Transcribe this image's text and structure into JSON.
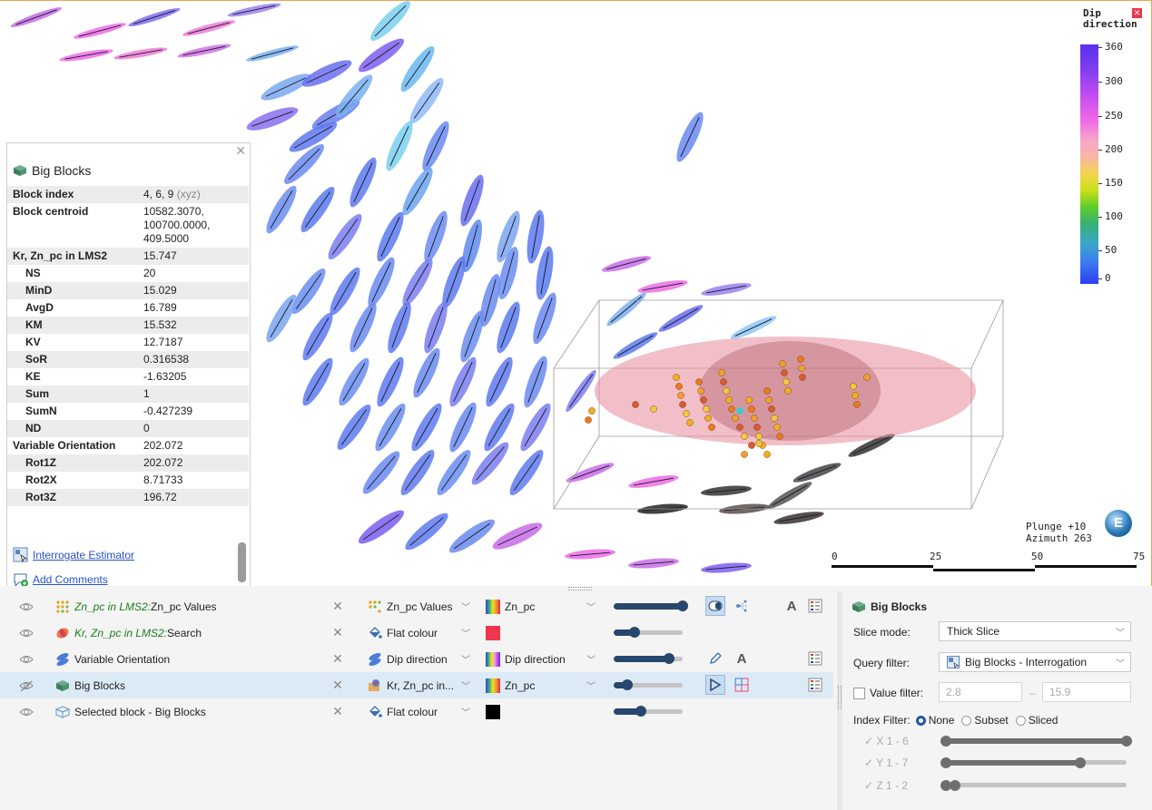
{
  "legend": {
    "title": "Dip direction",
    "ticks": [
      "360",
      "300",
      "250",
      "200",
      "150",
      "100",
      "50",
      "0"
    ]
  },
  "info_panel": {
    "title": "Big Blocks",
    "block_index_label": "Block index",
    "block_index_value": "4, 6, 9",
    "block_index_suffix": "(xyz)",
    "block_centroid_label": "Block centroid",
    "block_centroid_lines": [
      "10582.3070,",
      "100700.0000,",
      "409.5000"
    ],
    "rows": [
      {
        "k": "Kr, Zn_pc in LMS2",
        "v": "15.747",
        "indent": false
      },
      {
        "k": "NS",
        "v": "20",
        "indent": true
      },
      {
        "k": "MinD",
        "v": "15.029",
        "indent": true
      },
      {
        "k": "AvgD",
        "v": "16.789",
        "indent": true
      },
      {
        "k": "KM",
        "v": "15.532",
        "indent": true
      },
      {
        "k": "KV",
        "v": "12.7187",
        "indent": true
      },
      {
        "k": "SoR",
        "v": "0.316538",
        "indent": true
      },
      {
        "k": "KE",
        "v": "-1.63205",
        "indent": true
      },
      {
        "k": "Sum",
        "v": "1",
        "indent": true
      },
      {
        "k": "SumN",
        "v": "-0.427239",
        "indent": true
      },
      {
        "k": "ND",
        "v": "0",
        "indent": true
      },
      {
        "k": "Variable Orientation",
        "v": "202.072",
        "indent": false
      },
      {
        "k": "Rot1Z",
        "v": "202.072",
        "indent": true
      },
      {
        "k": "Rot2X",
        "v": "8.71733",
        "indent": true
      },
      {
        "k": "Rot3Z",
        "v": "196.72",
        "indent": true
      }
    ],
    "interrogate_link": "Interrogate Estimator",
    "comments_link": "Add Comments"
  },
  "view": {
    "plunge": "Plunge +10",
    "azimuth": "Azimuth 263",
    "compass_letter": "E",
    "scale_labels": [
      "0",
      "25",
      "50",
      "75"
    ]
  },
  "layers": [
    {
      "name_italic": "Zn_pc in LMS2:",
      "name": " Zn_pc Values",
      "colour_mode": "Zn_pc Values",
      "swatch_label": "Zn_pc",
      "icon": "points-icon",
      "opacity": 1.0,
      "selected": false,
      "hidden": false
    },
    {
      "name_italic": "Kr, Zn_pc in LMS2:",
      "name": " Search",
      "colour_mode": "Flat colour",
      "swatch_label": "",
      "icon": "search-ellipsoid-icon",
      "opacity": 0.3,
      "selected": false,
      "hidden": false
    },
    {
      "name_italic": "",
      "name": "Variable Orientation",
      "colour_mode": "Dip direction",
      "swatch_label": "Dip direction",
      "icon": "orientation-icon",
      "opacity": 0.8,
      "selected": false,
      "hidden": false
    },
    {
      "name_italic": "",
      "name": "Big Blocks",
      "colour_mode": "Kr, Zn_pc in...",
      "swatch_label": "Zn_pc",
      "icon": "block-model-icon",
      "opacity": 0.2,
      "selected": true,
      "hidden": true
    },
    {
      "name_italic": "",
      "name": "Selected block - Big Blocks",
      "colour_mode": "Flat colour",
      "swatch_label": "",
      "icon": "selected-block-icon",
      "opacity": 0.4,
      "selected": false,
      "hidden": false
    }
  ],
  "colors": {
    "flat_red": "#ef3550",
    "flat_black": "#000000",
    "accent": "#27476e",
    "viewport_border": "#f2a64a"
  },
  "properties": {
    "title": "Big Blocks",
    "slice_mode_label": "Slice mode:",
    "slice_mode_value": "Thick Slice",
    "query_filter_label": "Query filter:",
    "query_filter_value": "Big Blocks - Interrogation",
    "value_filter_label": "Value filter:",
    "value_min": "2.8",
    "value_sep": "–",
    "value_max": "15.9",
    "index_filter_label": "Index Filter:",
    "index_options": [
      "None",
      "Subset",
      "Sliced"
    ],
    "index_selected": "None",
    "ranges": [
      {
        "label": "X  1 - 6"
      },
      {
        "label": "Y  1 - 7"
      },
      {
        "label": "Z  1 - 2"
      }
    ]
  }
}
